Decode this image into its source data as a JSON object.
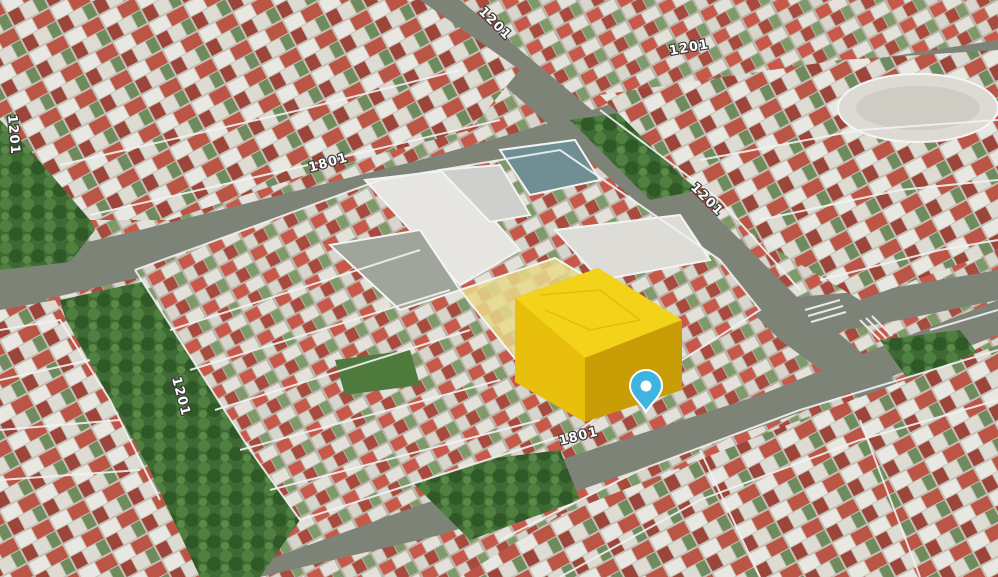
{
  "map": {
    "view": "3D satellite",
    "colors": {
      "road": "#7e8377",
      "lot_outline": "#f2f2f2",
      "highlight_volume": "#f1c40f",
      "highlight_parcel": "#e8d98a",
      "pin": "#3fb4e0"
    },
    "street_labels": [
      {
        "text": "1801"
      },
      {
        "text": "1801"
      },
      {
        "text": "1201"
      },
      {
        "text": "1201"
      },
      {
        "text": "1201"
      },
      {
        "text": "1201"
      },
      {
        "text": "1201"
      }
    ],
    "marker": {
      "icon": "location-pin-icon"
    }
  }
}
